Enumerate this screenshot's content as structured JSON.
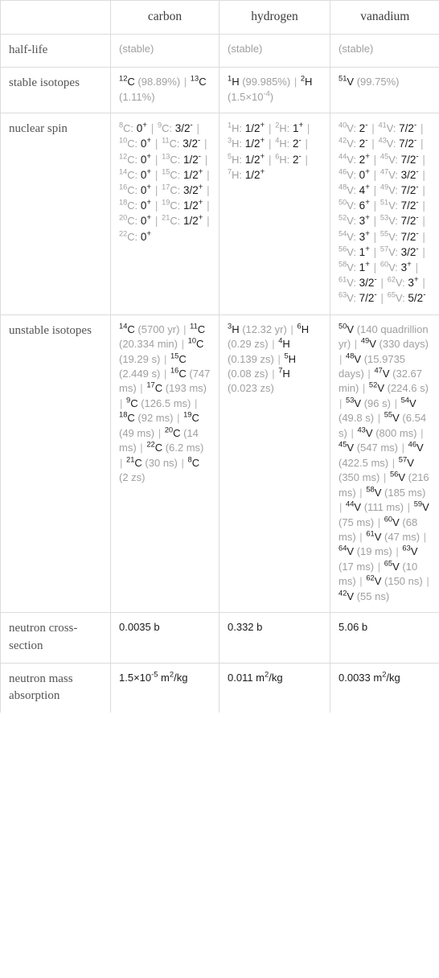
{
  "table": {
    "columns": [
      "carbon",
      "hydrogen",
      "vanadium"
    ],
    "rows": [
      {
        "label": "half-life",
        "cells": [
          {
            "html": "<span class=\"muted\">(stable)</span>"
          },
          {
            "html": "<span class=\"muted\">(stable)</span>"
          },
          {
            "html": "<span class=\"muted\">(stable)</span>"
          }
        ]
      },
      {
        "label": "stable isotopes",
        "cells": [
          {
            "html": "<sup>12</sup>C <span class=\"muted\">(98.89%)</span> <span class=\"sep\">|</span> <sup>13</sup>C <span class=\"muted\">(1.11%)</span>"
          },
          {
            "html": "<sup>1</sup>H <span class=\"muted\">(99.985%)</span> <span class=\"sep\">|</span> <sup>2</sup>H <span class=\"muted\">(1.5×10<sup>-4</sup>)</span>"
          },
          {
            "html": "<sup>51</sup>V <span class=\"muted\">(99.75%)</span>"
          }
        ]
      },
      {
        "label": "nuclear spin",
        "cells": [
          {
            "html": "<span class=\"muted\"><sup>8</sup>C:</span> <span class=\"spin-val\">0<sup>+</sup></span> <span class=\"sep\">|</span> <span class=\"muted\"><sup>9</sup>C:</span> <span class=\"spin-val\">3/2<sup>-</sup></span> <span class=\"sep\">|</span> <span class=\"muted\"><sup>10</sup>C:</span> <span class=\"spin-val\">0<sup>+</sup></span> <span class=\"sep\">|</span> <span class=\"muted\"><sup>11</sup>C:</span> <span class=\"spin-val\">3/2<sup>-</sup></span> <span class=\"sep\">|</span> <span class=\"muted\"><sup>12</sup>C:</span> <span class=\"spin-val\">0<sup>+</sup></span> <span class=\"sep\">|</span> <span class=\"muted\"><sup>13</sup>C:</span> <span class=\"spin-val\">1/2<sup>-</sup></span> <span class=\"sep\">|</span> <span class=\"muted\"><sup>14</sup>C:</span> <span class=\"spin-val\">0<sup>+</sup></span> <span class=\"sep\">|</span> <span class=\"muted\"><sup>15</sup>C:</span> <span class=\"spin-val\">1/2<sup>+</sup></span> <span class=\"sep\">|</span> <span class=\"muted\"><sup>16</sup>C:</span> <span class=\"spin-val\">0<sup>+</sup></span> <span class=\"sep\">|</span> <span class=\"muted\"><sup>17</sup>C:</span> <span class=\"spin-val\">3/2<sup>+</sup></span> <span class=\"sep\">|</span> <span class=\"muted\"><sup>18</sup>C:</span> <span class=\"spin-val\">0<sup>+</sup></span> <span class=\"sep\">|</span> <span class=\"muted\"><sup>19</sup>C:</span> <span class=\"spin-val\">1/2<sup>+</sup></span> <span class=\"sep\">|</span> <span class=\"muted\"><sup>20</sup>C:</span> <span class=\"spin-val\">0<sup>+</sup></span> <span class=\"sep\">|</span> <span class=\"muted\"><sup>21</sup>C:</span> <span class=\"spin-val\">1/2<sup>+</sup></span> <span class=\"sep\">|</span> <span class=\"muted\"><sup>22</sup>C:</span> <span class=\"spin-val\">0<sup>+</sup></span>"
          },
          {
            "html": "<span class=\"muted\"><sup>1</sup>H:</span> <span class=\"spin-val\">1/2<sup>+</sup></span> <span class=\"sep\">|</span> <span class=\"muted\"><sup>2</sup>H:</span> <span class=\"spin-val\">1<sup>+</sup></span> <span class=\"sep\">|</span> <span class=\"muted\"><sup>3</sup>H:</span> <span class=\"spin-val\">1/2<sup>+</sup></span> <span class=\"sep\">|</span> <span class=\"muted\"><sup>4</sup>H:</span> <span class=\"spin-val\">2<sup>-</sup></span> <span class=\"sep\">|</span> <span class=\"muted\"><sup>5</sup>H:</span> <span class=\"spin-val\">1/2<sup>+</sup></span> <span class=\"sep\">|</span> <span class=\"muted\"><sup>6</sup>H:</span> <span class=\"spin-val\">2<sup>-</sup></span> <span class=\"sep\">|</span> <span class=\"muted\"><sup>7</sup>H:</span> <span class=\"spin-val\">1/2<sup>+</sup></span>"
          },
          {
            "html": "<span class=\"muted\"><sup>40</sup>V:</span> <span class=\"spin-val\">2<sup>-</sup></span> <span class=\"sep\">|</span> <span class=\"muted\"><sup>41</sup>V:</span> <span class=\"spin-val\">7/2<sup>-</sup></span> <span class=\"sep\">|</span> <span class=\"muted\"><sup>42</sup>V:</span> <span class=\"spin-val\">2<sup>-</sup></span> <span class=\"sep\">|</span> <span class=\"muted\"><sup>43</sup>V:</span> <span class=\"spin-val\">7/2<sup>-</sup></span> <span class=\"sep\">|</span> <span class=\"muted\"><sup>44</sup>V:</span> <span class=\"spin-val\">2<sup>+</sup></span> <span class=\"sep\">|</span> <span class=\"muted\"><sup>45</sup>V:</span> <span class=\"spin-val\">7/2<sup>-</sup></span> <span class=\"sep\">|</span> <span class=\"muted\"><sup>46</sup>V:</span> <span class=\"spin-val\">0<sup>+</sup></span> <span class=\"sep\">|</span> <span class=\"muted\"><sup>47</sup>V:</span> <span class=\"spin-val\">3/2<sup>-</sup></span> <span class=\"sep\">|</span> <span class=\"muted\"><sup>48</sup>V:</span> <span class=\"spin-val\">4<sup>+</sup></span> <span class=\"sep\">|</span> <span class=\"muted\"><sup>49</sup>V:</span> <span class=\"spin-val\">7/2<sup>-</sup></span> <span class=\"sep\">|</span> <span class=\"muted\"><sup>50</sup>V:</span> <span class=\"spin-val\">6<sup>+</sup></span> <span class=\"sep\">|</span> <span class=\"muted\"><sup>51</sup>V:</span> <span class=\"spin-val\">7/2<sup>-</sup></span> <span class=\"sep\">|</span> <span class=\"muted\"><sup>52</sup>V:</span> <span class=\"spin-val\">3<sup>+</sup></span> <span class=\"sep\">|</span> <span class=\"muted\"><sup>53</sup>V:</span> <span class=\"spin-val\">7/2<sup>-</sup></span> <span class=\"sep\">|</span> <span class=\"muted\"><sup>54</sup>V:</span> <span class=\"spin-val\">3<sup>+</sup></span> <span class=\"sep\">|</span> <span class=\"muted\"><sup>55</sup>V:</span> <span class=\"spin-val\">7/2<sup>-</sup></span> <span class=\"sep\">|</span> <span class=\"muted\"><sup>56</sup>V:</span> <span class=\"spin-val\">1<sup>+</sup></span> <span class=\"sep\">|</span> <span class=\"muted\"><sup>57</sup>V:</span> <span class=\"spin-val\">3/2<sup>-</sup></span> <span class=\"sep\">|</span> <span class=\"muted\"><sup>58</sup>V:</span> <span class=\"spin-val\">1<sup>+</sup></span> <span class=\"sep\">|</span> <span class=\"muted\"><sup>60</sup>V:</span> <span class=\"spin-val\">3<sup>+</sup></span> <span class=\"sep\">|</span> <span class=\"muted\"><sup>61</sup>V:</span> <span class=\"spin-val\">3/2<sup>-</sup></span> <span class=\"sep\">|</span> <span class=\"muted\"><sup>62</sup>V:</span> <span class=\"spin-val\">3<sup>+</sup></span> <span class=\"sep\">|</span> <span class=\"muted\"><sup>63</sup>V:</span> <span class=\"spin-val\">7/2<sup>-</sup></span> <span class=\"sep\">|</span> <span class=\"muted\"><sup>65</sup>V:</span> <span class=\"spin-val\">5/2<sup>-</sup></span>"
          }
        ]
      },
      {
        "label": "unstable isotopes",
        "cells": [
          {
            "html": "<sup>14</sup>C <span class=\"muted\">(5700 yr)</span> <span class=\"sep\">|</span> <sup>11</sup>C <span class=\"muted\">(20.334 min)</span> <span class=\"sep\">|</span> <sup>10</sup>C <span class=\"muted\">(19.29 s)</span> <span class=\"sep\">|</span> <sup>15</sup>C <span class=\"muted\">(2.449 s)</span> <span class=\"sep\">|</span> <sup>16</sup>C <span class=\"muted\">(747 ms)</span> <span class=\"sep\">|</span> <sup>17</sup>C <span class=\"muted\">(193 ms)</span> <span class=\"sep\">|</span> <sup>9</sup>C <span class=\"muted\">(126.5 ms)</span> <span class=\"sep\">|</span> <sup>18</sup>C <span class=\"muted\">(92 ms)</span> <span class=\"sep\">|</span> <sup>19</sup>C <span class=\"muted\">(49 ms)</span> <span class=\"sep\">|</span> <sup>20</sup>C <span class=\"muted\">(14 ms)</span> <span class=\"sep\">|</span> <sup>22</sup>C <span class=\"muted\">(6.2 ms)</span> <span class=\"sep\">|</span> <sup>21</sup>C <span class=\"muted\">(30 ns)</span> <span class=\"sep\">|</span> <sup>8</sup>C <span class=\"muted\">(2 zs)</span>"
          },
          {
            "html": "<sup>3</sup>H <span class=\"muted\">(12.32 yr)</span> <span class=\"sep\">|</span> <sup>6</sup>H <span class=\"muted\">(0.29 zs)</span> <span class=\"sep\">|</span> <sup>4</sup>H <span class=\"muted\">(0.139 zs)</span> <span class=\"sep\">|</span> <sup>5</sup>H <span class=\"muted\">(0.08 zs)</span> <span class=\"sep\">|</span> <sup>7</sup>H <span class=\"muted\">(0.023 zs)</span>"
          },
          {
            "html": "<sup>50</sup>V <span class=\"muted\">(140 quadrillion yr)</span> <span class=\"sep\">|</span> <sup>49</sup>V <span class=\"muted\">(330 days)</span> <span class=\"sep\">|</span> <sup>48</sup>V <span class=\"muted\">(15.9735 days)</span> <span class=\"sep\">|</span> <sup>47</sup>V <span class=\"muted\">(32.67 min)</span> <span class=\"sep\">|</span> <sup>52</sup>V <span class=\"muted\">(224.6 s)</span> <span class=\"sep\">|</span> <sup>53</sup>V <span class=\"muted\">(96 s)</span> <span class=\"sep\">|</span> <sup>54</sup>V <span class=\"muted\">(49.8 s)</span> <span class=\"sep\">|</span> <sup>55</sup>V <span class=\"muted\">(6.54 s)</span> <span class=\"sep\">|</span> <sup>43</sup>V <span class=\"muted\">(800 ms)</span> <span class=\"sep\">|</span> <sup>45</sup>V <span class=\"muted\">(547 ms)</span> <span class=\"sep\">|</span> <sup>46</sup>V <span class=\"muted\">(422.5 ms)</span> <span class=\"sep\">|</span> <sup>57</sup>V <span class=\"muted\">(350 ms)</span> <span class=\"sep\">|</span> <sup>56</sup>V <span class=\"muted\">(216 ms)</span> <span class=\"sep\">|</span> <sup>58</sup>V <span class=\"muted\">(185 ms)</span> <span class=\"sep\">|</span> <sup>44</sup>V <span class=\"muted\">(111 ms)</span> <span class=\"sep\">|</span> <sup>59</sup>V <span class=\"muted\">(75 ms)</span> <span class=\"sep\">|</span> <sup>60</sup>V <span class=\"muted\">(68 ms)</span> <span class=\"sep\">|</span> <sup>61</sup>V <span class=\"muted\">(47 ms)</span> <span class=\"sep\">|</span> <sup>64</sup>V <span class=\"muted\">(19 ms)</span> <span class=\"sep\">|</span> <sup>63</sup>V <span class=\"muted\">(17 ms)</span> <span class=\"sep\">|</span> <sup>65</sup>V <span class=\"muted\">(10 ms)</span> <span class=\"sep\">|</span> <sup>62</sup>V <span class=\"muted\">(150 ns)</span> <span class=\"sep\">|</span> <sup>42</sup>V <span class=\"muted\">(55 ns)</span>"
          }
        ]
      },
      {
        "label": "neutron cross-section",
        "cells": [
          {
            "html": "0.0035 b"
          },
          {
            "html": "0.332 b"
          },
          {
            "html": "5.06 b"
          }
        ]
      },
      {
        "label": "neutron mass absorption",
        "cells": [
          {
            "html": "1.5×10<sup>-5</sup> m<sup>2</sup>/kg"
          },
          {
            "html": "0.011 m<sup>2</sup>/kg"
          },
          {
            "html": "0.0033 m<sup>2</sup>/kg"
          }
        ]
      }
    ]
  }
}
